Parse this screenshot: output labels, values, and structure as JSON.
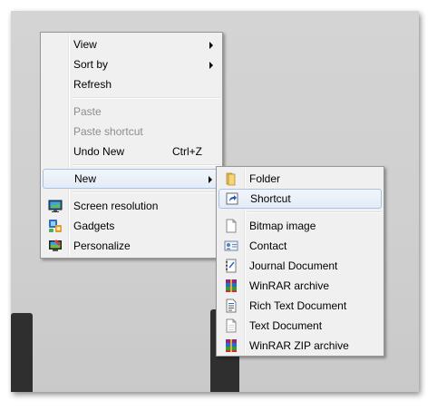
{
  "main_menu": {
    "items": [
      {
        "label": "View",
        "has_submenu": true
      },
      {
        "label": "Sort by",
        "has_submenu": true
      },
      {
        "label": "Refresh"
      },
      {
        "label": "Paste",
        "disabled": true
      },
      {
        "label": "Paste shortcut",
        "disabled": true
      },
      {
        "label": "Undo New",
        "shortcut": "Ctrl+Z"
      },
      {
        "label": "New",
        "has_submenu": true,
        "highlighted": true
      },
      {
        "label": "Screen resolution",
        "icon": "screen-resolution-icon"
      },
      {
        "label": "Gadgets",
        "icon": "gadgets-icon"
      },
      {
        "label": "Personalize",
        "icon": "personalize-icon"
      }
    ]
  },
  "new_submenu": {
    "items": [
      {
        "label": "Folder",
        "icon": "folder-icon"
      },
      {
        "label": "Shortcut",
        "icon": "shortcut-icon",
        "highlighted": true
      },
      {
        "label": "Bitmap image",
        "icon": "bitmap-icon"
      },
      {
        "label": "Contact",
        "icon": "contact-icon"
      },
      {
        "label": "Journal Document",
        "icon": "journal-icon"
      },
      {
        "label": "WinRAR archive",
        "icon": "winrar-icon"
      },
      {
        "label": "Rich Text Document",
        "icon": "rich-text-icon"
      },
      {
        "label": "Text Document",
        "icon": "text-document-icon"
      },
      {
        "label": "WinRAR ZIP archive",
        "icon": "winrar-zip-icon"
      }
    ]
  },
  "colors": {
    "menu_bg": "#f0f0f0",
    "highlight_border": "#a8c2e3",
    "disabled_text": "#8d8d8d",
    "desktop_bg": "#d0d0d0"
  }
}
